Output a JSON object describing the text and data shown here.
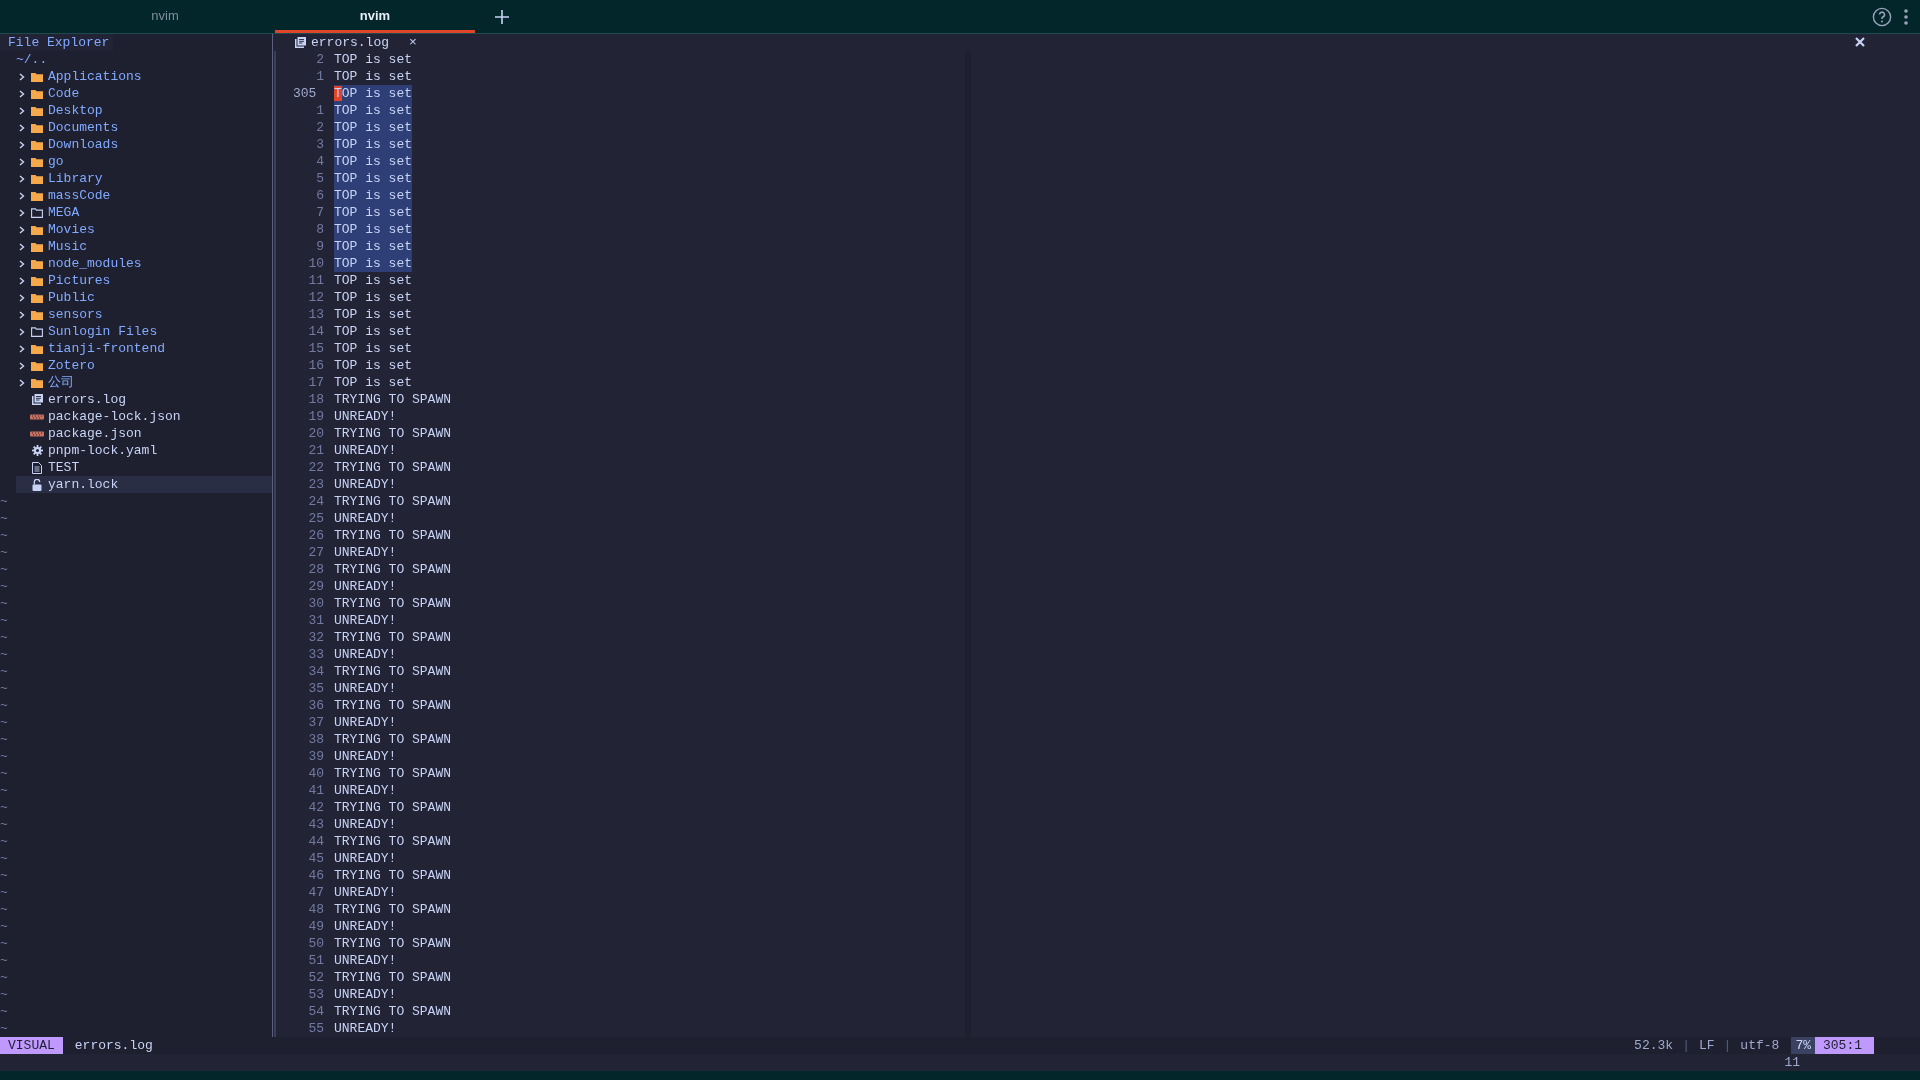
{
  "window_tabs": [
    {
      "label": "nvim",
      "selected": false
    },
    {
      "label": "nvim",
      "selected": true
    }
  ],
  "explorer": {
    "title": "File Explorer",
    "root": "~/..",
    "items": [
      {
        "name": "Applications",
        "kind": "folder",
        "expanded": false,
        "selected": false
      },
      {
        "name": "Code",
        "kind": "folder",
        "expanded": false,
        "selected": false
      },
      {
        "name": "Desktop",
        "kind": "folder",
        "expanded": false,
        "selected": false
      },
      {
        "name": "Documents",
        "kind": "folder",
        "expanded": false,
        "selected": false
      },
      {
        "name": "Downloads",
        "kind": "folder",
        "expanded": false,
        "selected": false
      },
      {
        "name": "go",
        "kind": "folder",
        "expanded": false,
        "selected": false
      },
      {
        "name": "Library",
        "kind": "folder",
        "expanded": false,
        "selected": false
      },
      {
        "name": "massCode",
        "kind": "folder",
        "expanded": false,
        "selected": false
      },
      {
        "name": "MEGA",
        "kind": "folder-outline",
        "expanded": false,
        "selected": false
      },
      {
        "name": "Movies",
        "kind": "folder",
        "expanded": false,
        "selected": false
      },
      {
        "name": "Music",
        "kind": "folder",
        "expanded": false,
        "selected": false
      },
      {
        "name": "node_modules",
        "kind": "folder",
        "expanded": false,
        "selected": false
      },
      {
        "name": "Pictures",
        "kind": "folder",
        "expanded": false,
        "selected": false
      },
      {
        "name": "Public",
        "kind": "folder",
        "expanded": false,
        "selected": false
      },
      {
        "name": "sensors",
        "kind": "folder",
        "expanded": false,
        "selected": false
      },
      {
        "name": "Sunlogin Files",
        "kind": "folder-outline",
        "expanded": false,
        "selected": false
      },
      {
        "name": "tianji-frontend",
        "kind": "folder",
        "expanded": false,
        "selected": false
      },
      {
        "name": "Zotero",
        "kind": "folder",
        "expanded": false,
        "selected": false
      },
      {
        "name": "公司",
        "kind": "folder",
        "expanded": false,
        "selected": false
      },
      {
        "name": "errors.log",
        "kind": "log",
        "selected": false
      },
      {
        "name": "package-lock.json",
        "kind": "json",
        "selected": false
      },
      {
        "name": "package.json",
        "kind": "json",
        "selected": false
      },
      {
        "name": "pnpm-lock.yaml",
        "kind": "config",
        "selected": false
      },
      {
        "name": "TEST",
        "kind": "text",
        "selected": false
      },
      {
        "name": "yarn.lock",
        "kind": "lock",
        "selected": true
      }
    ],
    "filler": [
      "~",
      "~",
      "~",
      "~",
      "~",
      "~",
      "~",
      "~",
      "~",
      "~",
      "~",
      "~",
      "~",
      "~",
      "~",
      "~",
      "~",
      "~",
      "~",
      "~",
      "~",
      "~",
      "~",
      "~",
      "~",
      "~",
      "~",
      "~",
      "~",
      "~",
      "~",
      "~"
    ]
  },
  "buffer_tab": {
    "name": "errors.log",
    "close": "×"
  },
  "editor": {
    "lines": [
      {
        "number": "2",
        "text": "TOP is set",
        "selected": false,
        "current": false
      },
      {
        "number": "1",
        "text": "TOP is set",
        "selected": false,
        "current": false
      },
      {
        "number": "305",
        "text": "TOP is set",
        "selected": true,
        "current": true
      },
      {
        "number": "1",
        "text": "TOP is set",
        "selected": true,
        "current": false
      },
      {
        "number": "2",
        "text": "TOP is set",
        "selected": true,
        "current": false
      },
      {
        "number": "3",
        "text": "TOP is set",
        "selected": true,
        "current": false
      },
      {
        "number": "4",
        "text": "TOP is set",
        "selected": true,
        "current": false
      },
      {
        "number": "5",
        "text": "TOP is set",
        "selected": true,
        "current": false
      },
      {
        "number": "6",
        "text": "TOP is set",
        "selected": true,
        "current": false
      },
      {
        "number": "7",
        "text": "TOP is set",
        "selected": true,
        "current": false
      },
      {
        "number": "8",
        "text": "TOP is set",
        "selected": true,
        "current": false
      },
      {
        "number": "9",
        "text": "TOP is set",
        "selected": true,
        "current": false
      },
      {
        "number": "10",
        "text": "TOP is set",
        "selected": true,
        "current": false
      },
      {
        "number": "11",
        "text": "TOP is set",
        "selected": false,
        "current": false
      },
      {
        "number": "12",
        "text": "TOP is set",
        "selected": false,
        "current": false
      },
      {
        "number": "13",
        "text": "TOP is set",
        "selected": false,
        "current": false
      },
      {
        "number": "14",
        "text": "TOP is set",
        "selected": false,
        "current": false
      },
      {
        "number": "15",
        "text": "TOP is set",
        "selected": false,
        "current": false
      },
      {
        "number": "16",
        "text": "TOP is set",
        "selected": false,
        "current": false
      },
      {
        "number": "17",
        "text": "TOP is set",
        "selected": false,
        "current": false
      },
      {
        "number": "18",
        "text": "TRYING TO SPAWN",
        "selected": false,
        "current": false
      },
      {
        "number": "19",
        "text": "UNREADY!",
        "selected": false,
        "current": false
      },
      {
        "number": "20",
        "text": "TRYING TO SPAWN",
        "selected": false,
        "current": false
      },
      {
        "number": "21",
        "text": "UNREADY!",
        "selected": false,
        "current": false
      },
      {
        "number": "22",
        "text": "TRYING TO SPAWN",
        "selected": false,
        "current": false
      },
      {
        "number": "23",
        "text": "UNREADY!",
        "selected": false,
        "current": false
      },
      {
        "number": "24",
        "text": "TRYING TO SPAWN",
        "selected": false,
        "current": false
      },
      {
        "number": "25",
        "text": "UNREADY!",
        "selected": false,
        "current": false
      },
      {
        "number": "26",
        "text": "TRYING TO SPAWN",
        "selected": false,
        "current": false
      },
      {
        "number": "27",
        "text": "UNREADY!",
        "selected": false,
        "current": false
      },
      {
        "number": "28",
        "text": "TRYING TO SPAWN",
        "selected": false,
        "current": false
      },
      {
        "number": "29",
        "text": "UNREADY!",
        "selected": false,
        "current": false
      },
      {
        "number": "30",
        "text": "TRYING TO SPAWN",
        "selected": false,
        "current": false
      },
      {
        "number": "31",
        "text": "UNREADY!",
        "selected": false,
        "current": false
      },
      {
        "number": "32",
        "text": "TRYING TO SPAWN",
        "selected": false,
        "current": false
      },
      {
        "number": "33",
        "text": "UNREADY!",
        "selected": false,
        "current": false
      },
      {
        "number": "34",
        "text": "TRYING TO SPAWN",
        "selected": false,
        "current": false
      },
      {
        "number": "35",
        "text": "UNREADY!",
        "selected": false,
        "current": false
      },
      {
        "number": "36",
        "text": "TRYING TO SPAWN",
        "selected": false,
        "current": false
      },
      {
        "number": "37",
        "text": "UNREADY!",
        "selected": false,
        "current": false
      },
      {
        "number": "38",
        "text": "TRYING TO SPAWN",
        "selected": false,
        "current": false
      },
      {
        "number": "39",
        "text": "UNREADY!",
        "selected": false,
        "current": false
      },
      {
        "number": "40",
        "text": "TRYING TO SPAWN",
        "selected": false,
        "current": false
      },
      {
        "number": "41",
        "text": "UNREADY!",
        "selected": false,
        "current": false
      },
      {
        "number": "42",
        "text": "TRYING TO SPAWN",
        "selected": false,
        "current": false
      },
      {
        "number": "43",
        "text": "UNREADY!",
        "selected": false,
        "current": false
      },
      {
        "number": "44",
        "text": "TRYING TO SPAWN",
        "selected": false,
        "current": false
      },
      {
        "number": "45",
        "text": "UNREADY!",
        "selected": false,
        "current": false
      },
      {
        "number": "46",
        "text": "TRYING TO SPAWN",
        "selected": false,
        "current": false
      },
      {
        "number": "47",
        "text": "UNREADY!",
        "selected": false,
        "current": false
      },
      {
        "number": "48",
        "text": "TRYING TO SPAWN",
        "selected": false,
        "current": false
      },
      {
        "number": "49",
        "text": "UNREADY!",
        "selected": false,
        "current": false
      },
      {
        "number": "50",
        "text": "TRYING TO SPAWN",
        "selected": false,
        "current": false
      },
      {
        "number": "51",
        "text": "UNREADY!",
        "selected": false,
        "current": false
      },
      {
        "number": "52",
        "text": "TRYING TO SPAWN",
        "selected": false,
        "current": false
      },
      {
        "number": "53",
        "text": "UNREADY!",
        "selected": false,
        "current": false
      },
      {
        "number": "54",
        "text": "TRYING TO SPAWN",
        "selected": false,
        "current": false
      },
      {
        "number": "55",
        "text": "UNREADY!",
        "selected": false,
        "current": false
      }
    ]
  },
  "status_bar": {
    "mode": "VISUAL",
    "file": "errors.log",
    "size": "52.3k",
    "separator_1": "|",
    "line_ending": "LF",
    "separator_2": "|",
    "encoding": "utf-8",
    "percent": "7%",
    "position": "305:1"
  },
  "command_line": "11"
}
